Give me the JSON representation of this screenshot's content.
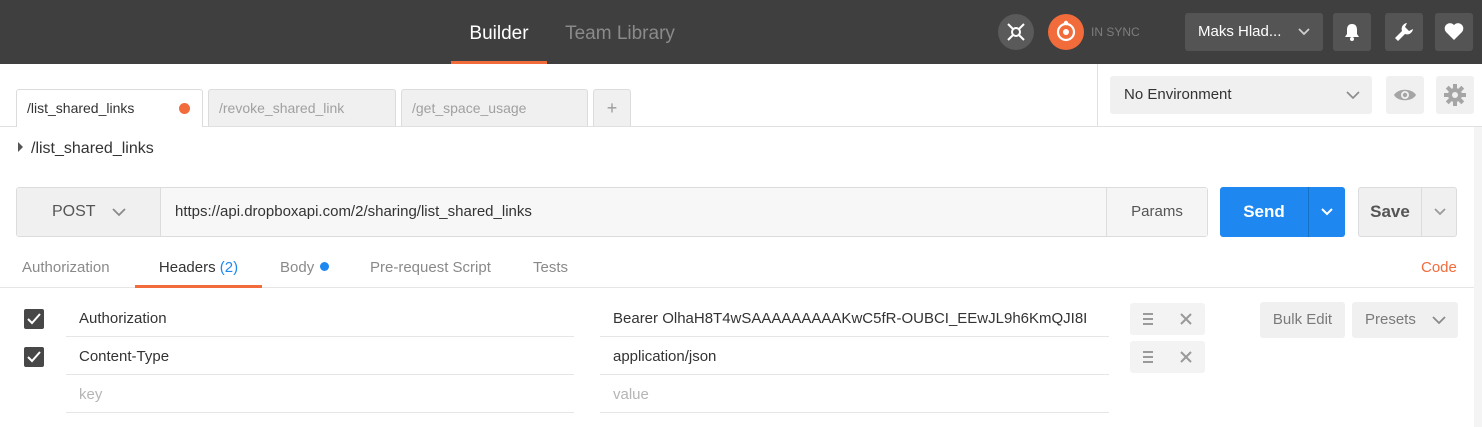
{
  "header": {
    "tabs": [
      {
        "label": "Builder",
        "active": true
      },
      {
        "label": "Team Library",
        "active": false
      }
    ],
    "sync_status": "IN SYNC",
    "user_name": "Maks Hlad...",
    "accent": "#f26b3a",
    "icons": [
      "interceptor-icon",
      "sync-icon",
      "bell-icon",
      "wrench-icon",
      "heart-icon"
    ]
  },
  "request_tabs": [
    {
      "label": "/list_shared_links",
      "active": true,
      "unsaved": true
    },
    {
      "label": "/revoke_shared_link",
      "active": false
    },
    {
      "label": "/get_space_usage",
      "active": false
    }
  ],
  "new_tab_label": "+",
  "environment": {
    "selected": "No Environment"
  },
  "breadcrumb": "/list_shared_links",
  "request": {
    "method": "POST",
    "url": "https://api.dropboxapi.com/2/sharing/list_shared_links",
    "params_label": "Params",
    "send_label": "Send",
    "save_label": "Save",
    "send_color": "#1e87f0"
  },
  "sub_tabs": {
    "authorization": "Authorization",
    "headers": "Headers",
    "headers_count": "(2)",
    "body": "Body",
    "prerequest": "Pre-request Script",
    "tests": "Tests",
    "code": "Code"
  },
  "headers": {
    "rows": [
      {
        "key": "Authorization",
        "value": "Bearer OlhaH8T4wSAAAAAAAAAKwC5fR-OUBCI_EEwJL9h6KmQJI8I",
        "checked": true
      },
      {
        "key": "Content-Type",
        "value": "application/json",
        "checked": true
      }
    ],
    "key_placeholder": "key",
    "value_placeholder": "value",
    "bulk_edit_label": "Bulk Edit",
    "presets_label": "Presets"
  }
}
